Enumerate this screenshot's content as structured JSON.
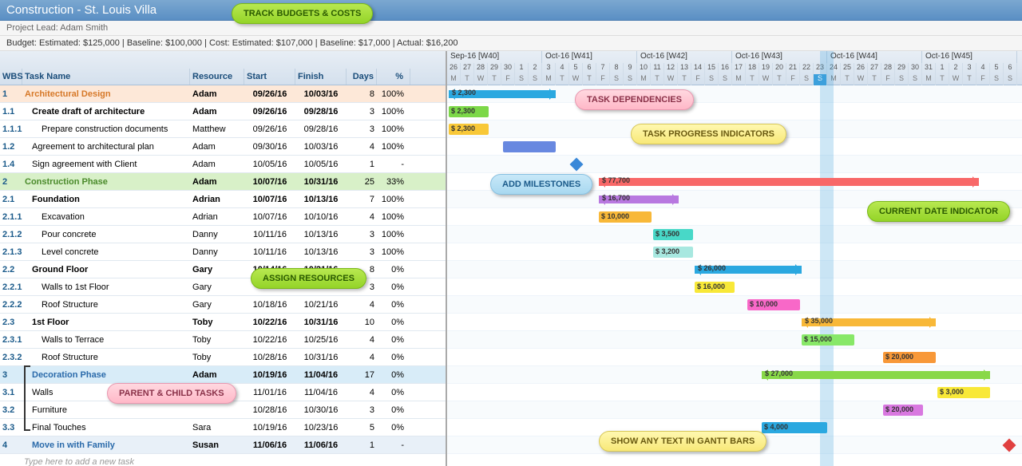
{
  "title": "Construction - St. Louis Villa",
  "lead": "Project Lead: Adam Smith",
  "budget_line": "Budget: Estimated: $125,000 | Baseline: $100,000 | Cost: Estimated: $107,000 | Baseline: $17,000 | Actual: $16,200",
  "cols": {
    "wbs": "WBS",
    "tn": "Task Name",
    "res": "Resource",
    "st": "Start",
    "fi": "Finish",
    "dy": "Days",
    "pc": "%"
  },
  "months": [
    "Sep-16   [W40]",
    "Oct-16   [W41]",
    "Oct-16   [W42]",
    "Oct-16   [W43]",
    "Oct-16   [W44]",
    "Oct-16   [W45]"
  ],
  "daynums": [
    "26",
    "27",
    "28",
    "29",
    "30",
    "1",
    "2",
    "3",
    "4",
    "5",
    "6",
    "7",
    "8",
    "9",
    "10",
    "11",
    "12",
    "13",
    "14",
    "15",
    "16",
    "17",
    "18",
    "19",
    "20",
    "21",
    "22",
    "23",
    "24",
    "25",
    "26",
    "27",
    "28",
    "29",
    "30",
    "31",
    "1",
    "2",
    "3",
    "4",
    "5",
    "6"
  ],
  "dows": [
    "M",
    "T",
    "W",
    "T",
    "F",
    "S",
    "S",
    "M",
    "T",
    "W",
    "T",
    "F",
    "S",
    "S",
    "M",
    "T",
    "W",
    "T",
    "F",
    "S",
    "S",
    "M",
    "T",
    "W",
    "T",
    "F",
    "S",
    "S",
    "M",
    "T",
    "W",
    "T",
    "F",
    "S",
    "S",
    "M",
    "T",
    "W",
    "T",
    "F",
    "S",
    "S"
  ],
  "rows": [
    {
      "cls": "r1",
      "wbs": "1",
      "tn": "Architectural Design",
      "res": "Adam",
      "st": "09/26/16",
      "fi": "10/03/16",
      "dy": "8",
      "pc": "100%"
    },
    {
      "cls": "rb",
      "wbs": "1.1",
      "tn": "Create draft of architecture",
      "ind": "i1",
      "res": "Adam",
      "st": "09/26/16",
      "fi": "09/28/16",
      "dy": "3",
      "pc": "100%"
    },
    {
      "cls": "",
      "wbs": "1.1.1",
      "tn": "Prepare construction documents",
      "ind": "i2",
      "res": "Matthew",
      "st": "09/26/16",
      "fi": "09/28/16",
      "dy": "3",
      "pc": "100%"
    },
    {
      "cls": "",
      "wbs": "1.2",
      "tn": "Agreement to architectural plan",
      "ind": "i1",
      "res": "Adam",
      "st": "09/30/16",
      "fi": "10/03/16",
      "dy": "4",
      "pc": "100%"
    },
    {
      "cls": "",
      "wbs": "1.4",
      "tn": "Sign agreement with Client",
      "ind": "i1",
      "res": "Adam",
      "st": "10/05/16",
      "fi": "10/05/16",
      "dy": "1",
      "pc": "-"
    },
    {
      "cls": "r2",
      "wbs": "2",
      "tn": "Construction Phase",
      "res": "Adam",
      "st": "10/07/16",
      "fi": "10/31/16",
      "dy": "25",
      "pc": "33%"
    },
    {
      "cls": "rb",
      "wbs": "2.1",
      "tn": "Foundation",
      "ind": "i1",
      "res": "Adrian",
      "st": "10/07/16",
      "fi": "10/13/16",
      "dy": "7",
      "pc": "100%"
    },
    {
      "cls": "",
      "wbs": "2.1.1",
      "tn": "Excavation",
      "ind": "i2",
      "res": "Adrian",
      "st": "10/07/16",
      "fi": "10/10/16",
      "dy": "4",
      "pc": "100%"
    },
    {
      "cls": "",
      "wbs": "2.1.2",
      "tn": "Pour concrete",
      "ind": "i2",
      "res": "Danny",
      "st": "10/11/16",
      "fi": "10/13/16",
      "dy": "3",
      "pc": "100%"
    },
    {
      "cls": "",
      "wbs": "2.1.3",
      "tn": "Level concrete",
      "ind": "i2",
      "res": "Danny",
      "st": "10/11/16",
      "fi": "10/13/16",
      "dy": "3",
      "pc": "100%"
    },
    {
      "cls": "rb",
      "wbs": "2.2",
      "tn": "Ground Floor",
      "ind": "i1",
      "res": "Gary",
      "st": "10/14/16",
      "fi": "10/21/16",
      "dy": "8",
      "pc": "0%"
    },
    {
      "cls": "",
      "wbs": "2.2.1",
      "tn": "Walls to 1st Floor",
      "ind": "i2",
      "res": "Gary",
      "st": "",
      "fi": "",
      "dy": "3",
      "pc": "0%"
    },
    {
      "cls": "",
      "wbs": "2.2.2",
      "tn": "Roof Structure",
      "ind": "i2",
      "res": "Gary",
      "st": "10/18/16",
      "fi": "10/21/16",
      "dy": "4",
      "pc": "0%"
    },
    {
      "cls": "rb",
      "wbs": "2.3",
      "tn": "1st Floor",
      "ind": "i1",
      "res": "Toby",
      "st": "10/22/16",
      "fi": "10/31/16",
      "dy": "10",
      "pc": "0%"
    },
    {
      "cls": "",
      "wbs": "2.3.1",
      "tn": "Walls to Terrace",
      "ind": "i2",
      "res": "Toby",
      "st": "10/22/16",
      "fi": "10/25/16",
      "dy": "4",
      "pc": "0%"
    },
    {
      "cls": "",
      "wbs": "2.3.2",
      "tn": "Roof Structure",
      "ind": "i2",
      "res": "Toby",
      "st": "10/28/16",
      "fi": "10/31/16",
      "dy": "4",
      "pc": "0%"
    },
    {
      "cls": "r3",
      "wbs": "3",
      "tn": "Decoration Phase",
      "ind": "i1",
      "res": "Adam",
      "st": "10/19/16",
      "fi": "11/04/16",
      "dy": "17",
      "pc": "0%"
    },
    {
      "cls": "",
      "wbs": "3.1",
      "tn": "Walls",
      "ind": "i1",
      "res": "",
      "st": "11/01/16",
      "fi": "11/04/16",
      "dy": "4",
      "pc": "0%"
    },
    {
      "cls": "",
      "wbs": "3.2",
      "tn": "Furniture",
      "ind": "i1",
      "res": "",
      "st": "10/28/16",
      "fi": "10/30/16",
      "dy": "3",
      "pc": "0%"
    },
    {
      "cls": "",
      "wbs": "3.3",
      "tn": "Final Touches",
      "ind": "i1",
      "res": "Sara",
      "st": "10/19/16",
      "fi": "10/23/16",
      "dy": "5",
      "pc": "0%"
    },
    {
      "cls": "r4",
      "wbs": "4",
      "tn": "Move in with Family",
      "ind": "i1",
      "res": "Susan",
      "st": "11/06/16",
      "fi": "11/06/16",
      "dy": "1",
      "pc": "-"
    }
  ],
  "newtask": "Type here to add a new task",
  "callouts": {
    "c1": "TRACK BUDGETS & COSTS",
    "c2": "TASK DEPENDENCIES",
    "c3": "TASK PROGRESS INDICATORS",
    "c4": "ADD MILESTONES",
    "c5": "CURRENT DATE INDICATOR",
    "c6": "ASSIGN RESOURCES",
    "c7": "PARENT & CHILD TASKS",
    "c8": "SHOW ANY TEXT IN GANTT BARS"
  },
  "bars": {
    "b0": "$ 2,300",
    "b1": "$ 2,300",
    "b2": "$ 2,300",
    "b5": "$ 77,700",
    "b6": "$ 16,700",
    "b7": "$ 10,000",
    "b8": "$ 3,500",
    "b9": "$ 3,200",
    "b10": "$ 26,000",
    "b11": "$ 16,000",
    "b12": "$ 10,000",
    "b13": "$ 35,000",
    "b14": "$ 15,000",
    "b15": "$ 20,000",
    "b16": "$ 27,000",
    "b17": "$ 3,000",
    "b18": "$ 20,000",
    "b19": "$ 4,000"
  }
}
